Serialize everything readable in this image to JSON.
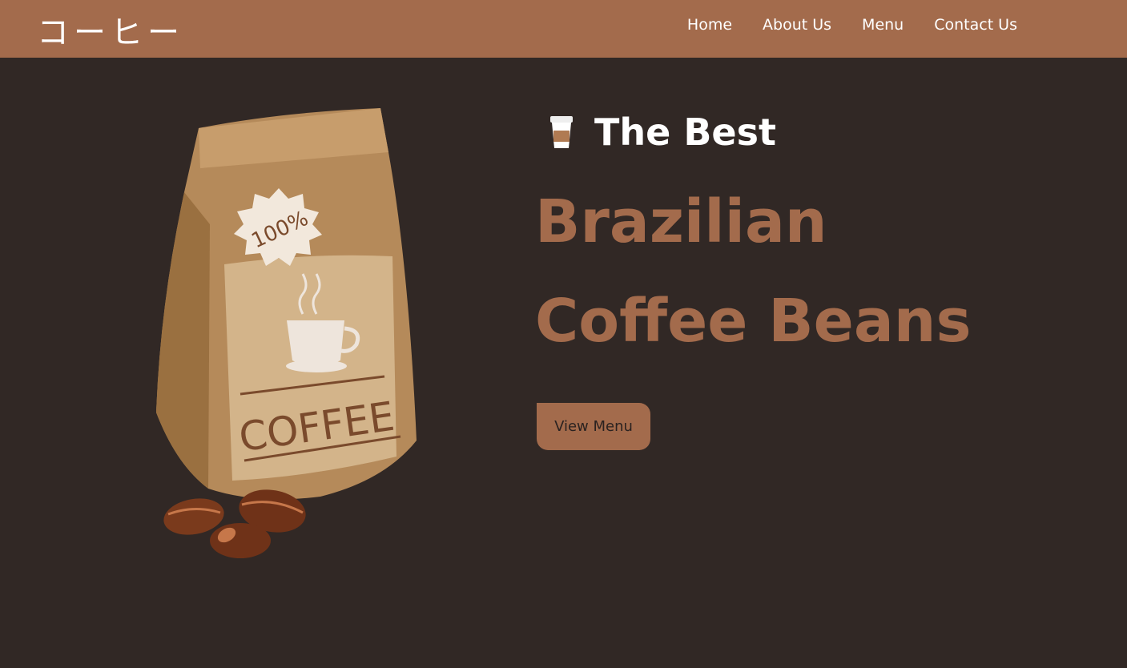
{
  "nav": {
    "logo": "コーヒー",
    "links": [
      "Home",
      "About Us",
      "Menu",
      "Contact Us"
    ]
  },
  "hero": {
    "tagline": "The Best",
    "headline_line1": "Brazilian",
    "headline_line2": "Coffee Beans",
    "cta_label": "View Menu",
    "bag_label": "COFFEE",
    "bag_badge": "100%"
  },
  "icons": {
    "tagline_icon": "coffee-cup-icon"
  },
  "colors": {
    "navbar": "#a36b4c",
    "background": "#312825",
    "accent": "#a36b4c",
    "text_light": "#ffffff"
  }
}
